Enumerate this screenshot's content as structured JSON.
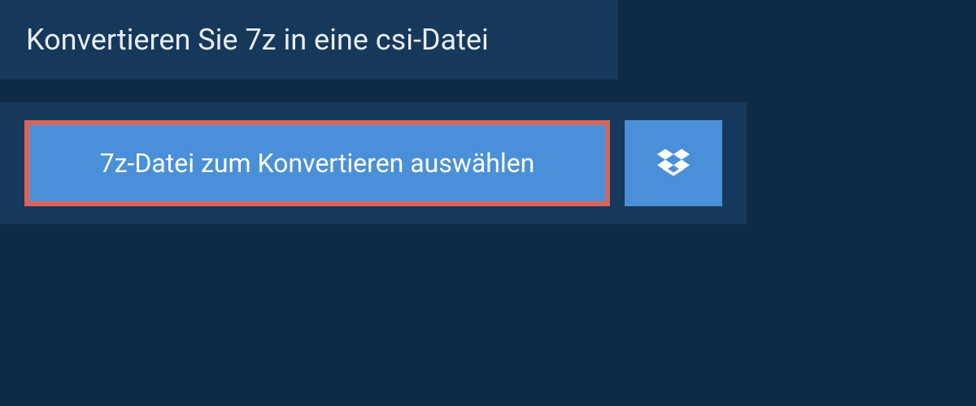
{
  "header": {
    "title": "Konvertieren Sie 7z in eine csi-Datei"
  },
  "actions": {
    "select_file_label": "7z-Datei zum Konvertieren auswählen",
    "dropbox_icon": "dropbox"
  },
  "colors": {
    "pageBg": "#0e2a47",
    "panelBg": "#16385b",
    "buttonBg": "#4a90d9",
    "highlightBorder": "#d96459",
    "text": "#e8eef4"
  }
}
